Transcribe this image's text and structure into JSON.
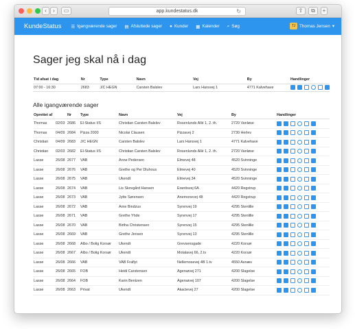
{
  "browser": {
    "url": "app.kundestatus.dk"
  },
  "navbar": {
    "brand": "KundeStatus",
    "items": [
      "Igangværende sager",
      "Afsluttede sager",
      "Kunder",
      "Kalender",
      "Søg"
    ],
    "user": "Thomas Jensen"
  },
  "page": {
    "title": "Sager jeg skal nå i dag"
  },
  "today_table": {
    "headers": [
      "Tid afsat i dag",
      "Nr",
      "Type",
      "Navn",
      "Vej",
      "By",
      "Handlinger"
    ],
    "rows": [
      [
        "07:00 - 16:30",
        "2683",
        "J/C HEGN",
        "Carsten Balslev",
        "Lars Hansvej 1",
        "4771 Kalvehave"
      ]
    ]
  },
  "all_cases": {
    "title": "Alle igangværende sager",
    "headers": [
      "Oprettet af",
      "Nr",
      "Type",
      "Navn",
      "Vej",
      "By",
      "Handlinger"
    ],
    "rows": [
      [
        "Thomas",
        "02/03",
        "2686",
        "El-Status I/S",
        "Christian Carsten Balslev",
        "Rosenlunds Allé 1, 2. th.",
        "2720 Vanløse"
      ],
      [
        "Thomas",
        "04/09",
        "2684",
        "Pizza 2000",
        "Nicolai Clausen",
        "Pizzavej 2",
        "2730 Herlev"
      ],
      [
        "Christian",
        "04/09",
        "2683",
        "J/C HEGN",
        "Carsten Balslev",
        "Lars Hansvej 1",
        "4771 Kalvehave"
      ],
      [
        "Christian",
        "02/03",
        "2682",
        "El-Status I/S",
        "Christian Carsten Balslev",
        "Rosenlunds Allé 1, 2. th.",
        "2720 Vanløse"
      ],
      [
        "Lasse",
        "26/08",
        "2677",
        "VAB",
        "Anne Pedersen",
        "Elmevej 48",
        "4520 Svinninge"
      ],
      [
        "Lasse",
        "26/08",
        "2676",
        "VAB",
        "Grethe og Per Dluhous",
        "Elmevej 40",
        "4520 Svinninge"
      ],
      [
        "Lasse",
        "26/08",
        "2675",
        "VAB",
        "Ukendt",
        "Elmevej 34",
        "4520 Svinninge"
      ],
      [
        "Lasse",
        "26/08",
        "2674",
        "VAB",
        "Lis Skovgård Hansen",
        "Erantisvej 6A",
        "4420 Regstrup"
      ],
      [
        "Lasse",
        "26/08",
        "2673",
        "VAB",
        "Jytte Sørensen",
        "Anemonevej 48",
        "4420 Regstrup"
      ],
      [
        "Lasse",
        "26/08",
        "2672",
        "VAB",
        "Arne Bindzus",
        "Syrenvej 19",
        "4295 Stenlille"
      ],
      [
        "Lasse",
        "26/08",
        "2671",
        "VAB",
        "Grethe Yhde",
        "Syrenvej 17",
        "4295 Stenlille"
      ],
      [
        "Lasse",
        "26/08",
        "2670",
        "VAB",
        "Birtha Christensen",
        "Syrenvej 15",
        "4295 Stenlille"
      ],
      [
        "Lasse",
        "26/08",
        "2669",
        "VAB",
        "Grethe Jensen",
        "Syrenvej 13",
        "4295 Stenlille"
      ],
      [
        "Lasse",
        "26/08",
        "2668",
        "Albo / Bolig Korsør",
        "Ukendt",
        "Grevsensgade",
        "4220 Korsør"
      ],
      [
        "Lasse",
        "26/08",
        "2667",
        "Albo / Bolig Korsør",
        "Ukendt",
        "Motalavej 66, 2.tv",
        "4220 Korsør"
      ],
      [
        "Lasse",
        "26/08",
        "2666",
        "VAB",
        "VAB Fraflyt",
        "Nellemosevej 4B 1.tv",
        "4550 Asnæs"
      ],
      [
        "Lasse",
        "26/08",
        "2665",
        "FOB",
        "Heidi Carstensen",
        "Agersøvej 271",
        "4200 Slagelse"
      ],
      [
        "Lasse",
        "26/08",
        "2664",
        "FOB",
        "Karin Bentzen",
        "Agersøvej 107",
        "4200 Slagelse"
      ],
      [
        "Lasse",
        "26/08",
        "2663",
        "Privat",
        "Ukendt",
        "Akacievej 27",
        "4200 Slagelse"
      ]
    ]
  },
  "actions": [
    "home-icon",
    "list-icon",
    "document-icon",
    "clock-icon",
    "image-icon",
    "chat-icon"
  ]
}
